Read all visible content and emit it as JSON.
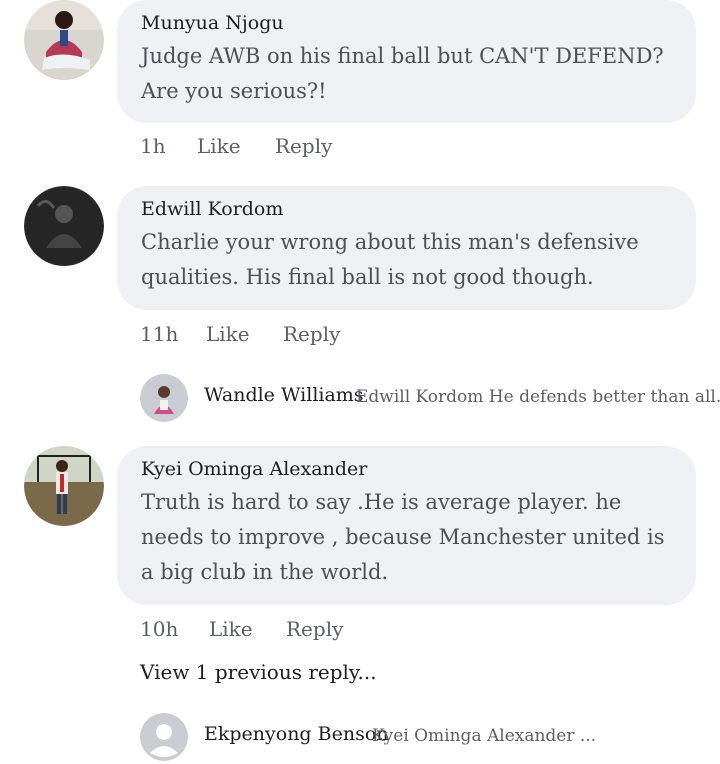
{
  "comments": [
    {
      "author": "Munyua Njogu",
      "text": "Judge AWB on his final ball but CAN'T DEFEND? Are you serious?!",
      "time": "1h",
      "like": "Like",
      "reply": "Reply"
    },
    {
      "author": "Edwill Kordom",
      "text": "Charlie your wrong about this man's defensive qualities. His final ball is not good though.",
      "time": "11h",
      "like": "Like",
      "reply": "Reply",
      "replies": [
        {
          "author": "Wandle Williams",
          "snippet": "Edwill Kordom He defends better than all..."
        }
      ]
    },
    {
      "author": "Kyei Ominga Alexander",
      "text": "Truth is hard to say .He is average player. he needs to improve , because Manchester united is a big club in the world.",
      "time": "10h",
      "like": "Like",
      "reply": "Reply",
      "view_previous": "View 1 previous reply...",
      "replies": [
        {
          "author": "Ekpenyong Benson",
          "snippet": "Kyei Ominga Alexander ..."
        }
      ]
    }
  ],
  "colors": {
    "bubble": "#eff0f3",
    "text": "#4b4f56",
    "meta": "#5b5f66"
  },
  "icons": {
    "default_avatar": "person-silhouette-icon"
  }
}
